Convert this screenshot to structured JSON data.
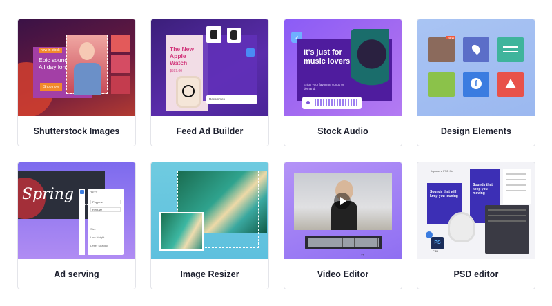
{
  "cards": [
    {
      "label": "Shutterstock Images",
      "thumb": {
        "badge": "new in stock",
        "headline": "Epic sound. All day long.",
        "cta": "Shop now"
      }
    },
    {
      "label": "Feed Ad Builder",
      "thumb": {
        "headline": "The New Apple Watch",
        "price": "$599.00",
        "field": "Recommen"
      }
    },
    {
      "label": "Stock Audio",
      "thumb": {
        "headline": "It's just for music lovers",
        "subtext": "Enjoy your favourite songs on demand."
      }
    },
    {
      "label": "Design Elements",
      "thumb": {
        "badge": "NEW"
      }
    },
    {
      "label": "Ad serving",
      "thumb": {
        "headline": "Spring",
        "panel_title": "TEXT",
        "panel_font": "Poppins",
        "panel_weight": "Regular",
        "panel_rows": [
          "Size",
          "Line Height",
          "Letter Spacing"
        ]
      }
    },
    {
      "label": "Image Resizer",
      "thumb": {}
    },
    {
      "label": "Video Editor",
      "thumb": {
        "badge": "30s"
      }
    },
    {
      "label": "PSD editor",
      "thumb": {
        "upload": "Upload a PSD file",
        "card_a": "Sounds that will keep you moving",
        "card_b": "Sounds that keep you moving",
        "badge": "PS",
        "badge2": "PSD"
      }
    }
  ],
  "colors": {
    "label_text": "#1c1f2e",
    "card_border": "#e4e5ea"
  }
}
